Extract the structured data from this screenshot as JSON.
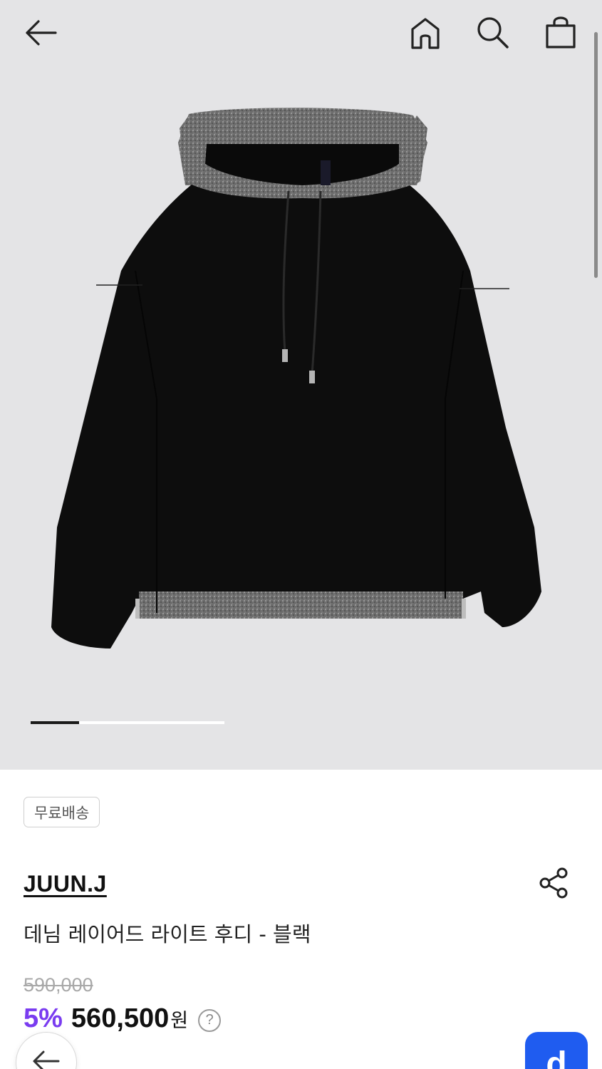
{
  "header": {
    "back_icon": "arrow-left-icon",
    "home_icon": "home-icon",
    "search_icon": "search-icon",
    "bag_icon": "shopping-bag-icon"
  },
  "gallery": {
    "image_alt": "denim layered hoodie black",
    "progress": 0.25
  },
  "product": {
    "badge": "무료배송",
    "brand": "JUUN.J",
    "name": "데님 레이어드 라이트 후디 - 블랙",
    "original_price": "590,000",
    "discount": "5%",
    "sale_price": "560,500",
    "currency": "원",
    "help_label": "?",
    "share_icon": "share-icon"
  },
  "floating": {
    "back_icon": "arrow-left-icon",
    "app_button_label": "d"
  },
  "colors": {
    "discount": "#7a3cf0",
    "app_button": "#1f5cf0",
    "hero_bg": "#e4e4e6"
  }
}
